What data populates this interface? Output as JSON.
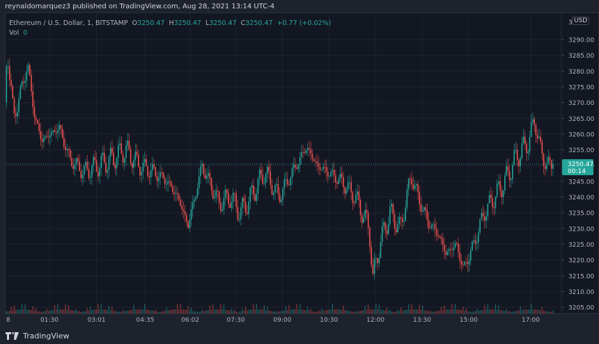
{
  "header": {
    "published": "reynaldomarquez3 published on TradingView.com, Aug 28, 2021 13:14 UTC-4"
  },
  "legend": {
    "symbol": "Ethereum / U.S. Dollar, 1, BITSTAMP",
    "o_label": "O",
    "o": "3250.47",
    "h_label": "H",
    "h": "3250.47",
    "l_label": "L",
    "l": "3250.47",
    "c_label": "C",
    "c": "3250.47",
    "change": "+0.77 (+0.02%)",
    "vol_label": "Vol",
    "vol": "0"
  },
  "axis": {
    "currency": "USD",
    "price_label": "3250.47",
    "countdown": "00:14"
  },
  "footer": {
    "brand": "TradingView"
  },
  "colors": {
    "up": "#26a69a",
    "down": "#ef5350",
    "bg": "#131722"
  },
  "chart_data": {
    "type": "candlestick",
    "title": "Ethereum / U.S. Dollar, 1, BITSTAMP",
    "ylim": [
      3203,
      3298
    ],
    "y_ticks": [
      3205,
      3210,
      3215,
      3220,
      3225,
      3230,
      3235,
      3240,
      3245,
      3250,
      3255,
      3260,
      3265,
      3270,
      3275,
      3280,
      3285,
      3290
    ],
    "x_ticks": [
      {
        "t": -2,
        "label": "8"
      },
      {
        "t": 90,
        "label": "01:30"
      },
      {
        "t": 181,
        "label": "03:01"
      },
      {
        "t": 275,
        "label": "04:35"
      },
      {
        "t": 362,
        "label": "06:02"
      },
      {
        "t": 450,
        "label": "07:30"
      },
      {
        "t": 540,
        "label": "09:00"
      },
      {
        "t": 630,
        "label": "10:30"
      },
      {
        "t": 720,
        "label": "12:00"
      },
      {
        "t": 810,
        "label": "13:30"
      },
      {
        "t": 900,
        "label": "15:00"
      },
      {
        "t": 1020,
        "label": "17:00"
      }
    ],
    "price_path_minutes_price": [
      [
        5,
        3270
      ],
      [
        8,
        3288
      ],
      [
        21,
        3265
      ],
      [
        48,
        3282
      ],
      [
        62,
        3265
      ],
      [
        75,
        3258
      ],
      [
        109,
        3262
      ],
      [
        129,
        3252
      ],
      [
        156,
        3248
      ],
      [
        183,
        3250
      ],
      [
        210,
        3252
      ],
      [
        237,
        3255
      ],
      [
        264,
        3250
      ],
      [
        291,
        3248
      ],
      [
        317,
        3245
      ],
      [
        338,
        3240
      ],
      [
        358,
        3231
      ],
      [
        385,
        3250
      ],
      [
        398,
        3245
      ],
      [
        418,
        3238
      ],
      [
        439,
        3240
      ],
      [
        459,
        3235
      ],
      [
        479,
        3240
      ],
      [
        506,
        3248
      ],
      [
        533,
        3240
      ],
      [
        560,
        3248
      ],
      [
        587,
        3256
      ],
      [
        607,
        3250
      ],
      [
        627,
        3248
      ],
      [
        654,
        3245
      ],
      [
        681,
        3240
      ],
      [
        708,
        3230
      ],
      [
        715,
        3214
      ],
      [
        728,
        3225
      ],
      [
        748,
        3235
      ],
      [
        768,
        3230
      ],
      [
        789,
        3247
      ],
      [
        802,
        3240
      ],
      [
        822,
        3232
      ],
      [
        842,
        3228
      ],
      [
        856,
        3222
      ],
      [
        876,
        3225
      ],
      [
        890,
        3217
      ],
      [
        910,
        3225
      ],
      [
        930,
        3235
      ],
      [
        950,
        3240
      ],
      [
        970,
        3245
      ],
      [
        990,
        3252
      ],
      [
        1017,
        3258
      ],
      [
        1028,
        3265
      ],
      [
        1038,
        3255
      ],
      [
        1051,
        3250
      ],
      [
        1065,
        3250.47
      ]
    ],
    "volume_spike": {
      "t": 360,
      "relative": 1.0
    },
    "last_price": 3250.47
  }
}
